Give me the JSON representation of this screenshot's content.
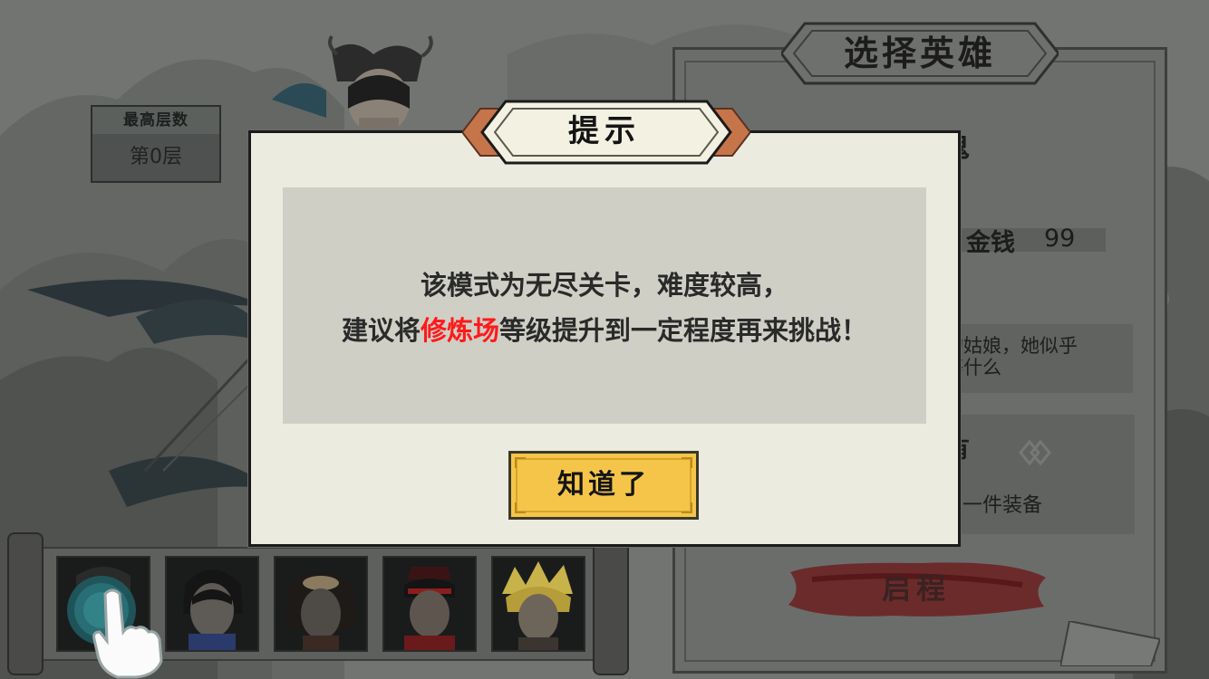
{
  "record": {
    "title": "最高层数",
    "value": "第0层"
  },
  "hero_panel": {
    "title": "选择英雄",
    "gold_label": "金钱",
    "gold_value": "99",
    "partial_top_glyph": "鬼",
    "description_line1": "的姑娘，她似乎",
    "description_line2": "等什么",
    "equip_heading_glyph": "有",
    "equip_text": "一件装备",
    "start_button_label": "启程"
  },
  "dialog": {
    "title": "提示",
    "line1": "该模式为无尽关卡，难度较高，",
    "line2_before": "建议将",
    "line2_highlight": "修炼场",
    "line2_after": "等级提升到一定程度再来挑战！",
    "confirm_button_label": "知道了",
    "highlight_color": "#ff1a1a"
  },
  "hero_roster": [
    {
      "name": "hero-1",
      "selected": true
    },
    {
      "name": "hero-2",
      "selected": false
    },
    {
      "name": "hero-3",
      "selected": false
    },
    {
      "name": "hero-4",
      "selected": false
    },
    {
      "name": "hero-5",
      "selected": false
    }
  ],
  "colors": {
    "dialog_bg": "#ecebe0",
    "message_bg": "#cfcfc6",
    "confirm_button": "#f5c54a",
    "banner_orange": "#c6754a",
    "start_button_ink": "#6b2020"
  }
}
